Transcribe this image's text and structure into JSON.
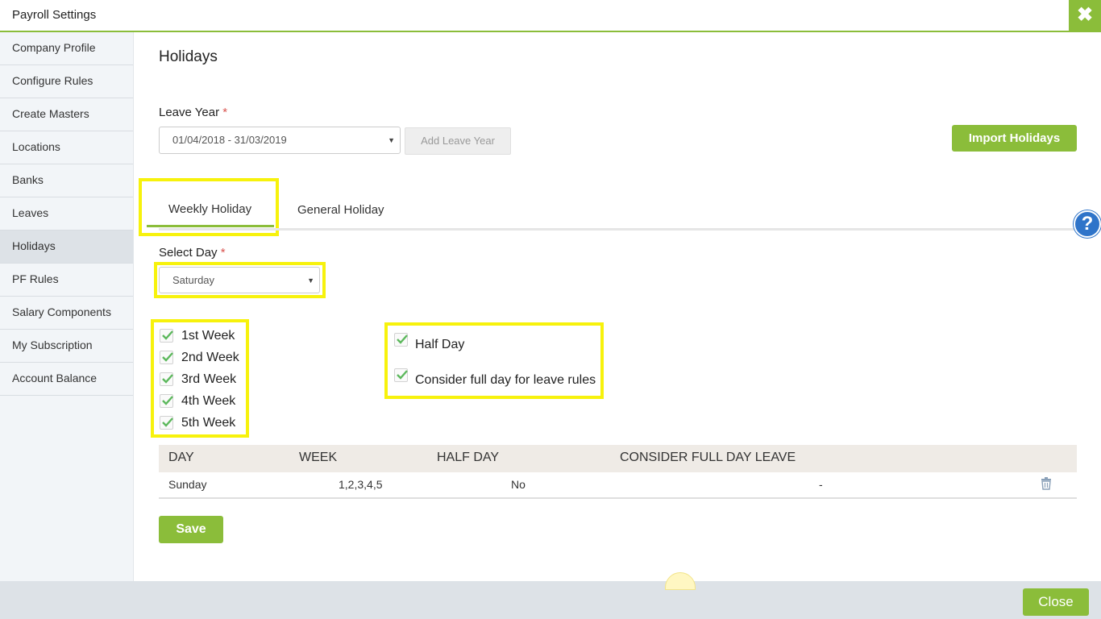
{
  "window": {
    "title": "Payroll Settings"
  },
  "sidebar": {
    "items": [
      {
        "label": "Company Profile"
      },
      {
        "label": "Configure Rules"
      },
      {
        "label": "Create Masters"
      },
      {
        "label": "Locations"
      },
      {
        "label": "Banks"
      },
      {
        "label": "Leaves"
      },
      {
        "label": "Holidays",
        "active": true
      },
      {
        "label": "PF Rules"
      },
      {
        "label": "Salary Components"
      },
      {
        "label": "My Subscription"
      },
      {
        "label": "Account Balance"
      }
    ]
  },
  "page": {
    "title": "Holidays"
  },
  "leave_year": {
    "label": "Leave Year",
    "required_mark": "*",
    "selected": "01/04/2018 - 31/03/2019",
    "add_button": "Add Leave Year"
  },
  "import_button": "Import Holidays",
  "tabs": [
    {
      "label": "Weekly Holiday",
      "active": true
    },
    {
      "label": "General Holiday"
    }
  ],
  "select_day": {
    "label": "Select Day",
    "required_mark": "*",
    "selected": "Saturday"
  },
  "weeks": [
    {
      "label": "1st Week",
      "checked": true
    },
    {
      "label": "2nd Week",
      "checked": true
    },
    {
      "label": "3rd Week",
      "checked": true
    },
    {
      "label": "4th Week",
      "checked": true
    },
    {
      "label": "5th Week",
      "checked": true
    }
  ],
  "options": {
    "half_day": {
      "label": "Half Day",
      "checked": true
    },
    "full_day_leave": {
      "label": "Consider full day for leave rules",
      "checked": true
    }
  },
  "table": {
    "headers": [
      "DAY",
      "WEEK",
      "HALF DAY",
      "CONSIDER FULL DAY LEAVE"
    ],
    "rows": [
      {
        "day": "Sunday",
        "week": "1,2,3,4,5",
        "half_day": "No",
        "full_day_leave": "-"
      }
    ]
  },
  "save_button": "Save",
  "close_button": "Close",
  "icons": {
    "close": "close-icon",
    "help": "help-icon",
    "checkbox": "checkmark-icon",
    "delete": "trash-icon",
    "dropdown": "caret-down-icon"
  },
  "colors": {
    "accent": "#8bbd3a",
    "highlight": "#f7f20c",
    "help": "#2f74c9"
  }
}
